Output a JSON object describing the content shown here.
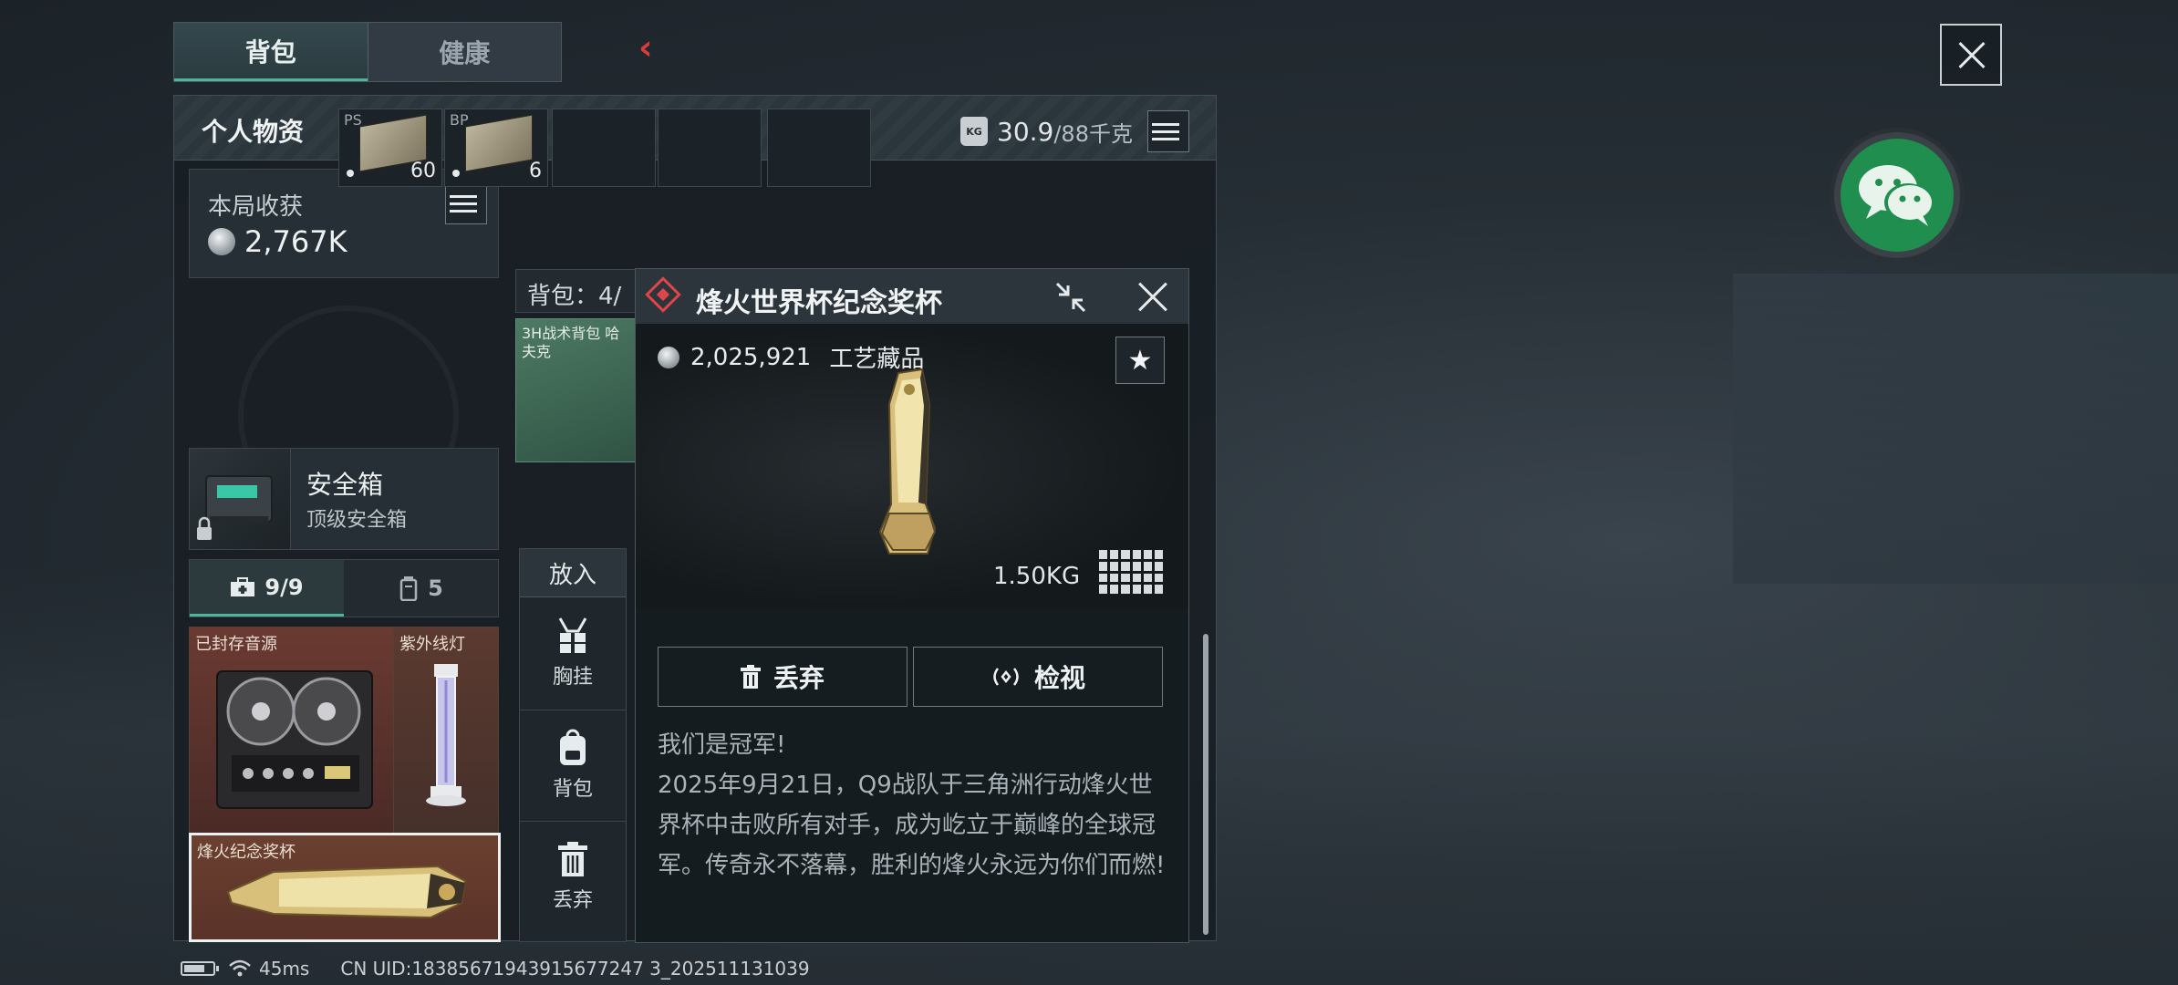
{
  "tabs": [
    {
      "label": "背包",
      "active": true
    },
    {
      "label": "健康",
      "active": false
    }
  ],
  "panel": {
    "title": "个人物资",
    "weight_current": "30.9",
    "weight_max": "/88千克"
  },
  "earnings": {
    "label": "本局收获",
    "value": "2,767K"
  },
  "safebox": {
    "title": "安全箱",
    "subtitle": "顶级安全箱"
  },
  "container_tabs": [
    {
      "label": "9/9",
      "icon": "medkit-icon",
      "active": true
    },
    {
      "label": "5",
      "icon": "canister-icon",
      "active": false
    }
  ],
  "safe_items": [
    {
      "label": "已封存音源"
    },
    {
      "label": "紫外线灯"
    },
    {
      "label": "烽火纪念奖杯"
    }
  ],
  "ammo_slots": [
    {
      "tag": "PS",
      "count": "60"
    },
    {
      "tag": "BP",
      "count": "6"
    }
  ],
  "backpack": {
    "label": "背包：4/",
    "item_label": "3H战术背包 哈夫克"
  },
  "side_menu": {
    "put_in": "放入",
    "options": [
      {
        "label": "胸挂",
        "icon": "chest-rig-icon"
      },
      {
        "label": "背包",
        "icon": "backpack-icon"
      },
      {
        "label": "丢弃",
        "icon": "trash-icon"
      }
    ]
  },
  "popup": {
    "title": "烽火世界杯纪念奖杯",
    "price": "2,025,921",
    "category": "工艺藏品",
    "weight": "1.50KG",
    "drop_label": "丢弃",
    "inspect_label": "检视",
    "description": [
      "我们是冠军!",
      "2025年9月21日，Q9战队于三角洲行动烽火世界杯中击败所有对手，成为屹立于巅峰的全球冠军。传奇永不落幕，胜利的烽火永远为你们而燃!"
    ]
  },
  "status_bar": {
    "ping": "45ms",
    "uid": "CN UID:18385671943915677247 3_202511131039"
  },
  "colors": {
    "accent_green": "#4fb59a",
    "danger_red": "#e0454a",
    "wechat_green": "#1f8e4e"
  }
}
